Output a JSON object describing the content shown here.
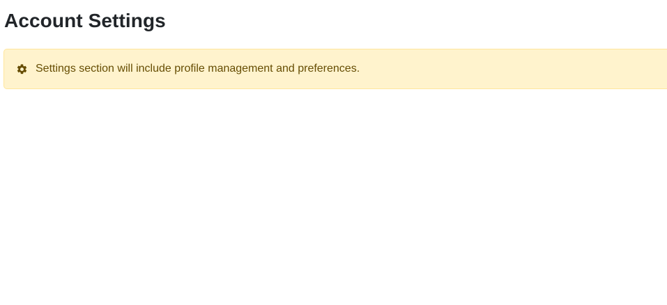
{
  "page": {
    "title": "Account Settings"
  },
  "alert": {
    "icon": "gear-icon",
    "message": "Settings section will include profile management and preferences.",
    "colors": {
      "background": "#fff3cd",
      "border": "#ffe69c",
      "text": "#664d03"
    }
  }
}
